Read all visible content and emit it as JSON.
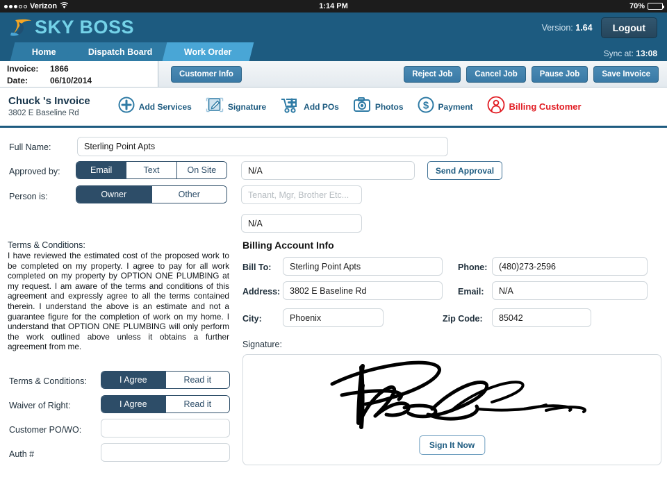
{
  "status_bar": {
    "carrier": "Verizon",
    "signal_dots_filled": 3,
    "signal_dots_empty": 2,
    "wifi_icon": "wifi-icon",
    "time": "1:14 PM",
    "battery_percent": "70%",
    "battery_level": 70
  },
  "header": {
    "brand": "SKY BOSS",
    "version_label": "Version:",
    "version_value": "1.64",
    "logout_label": "Logout",
    "sync_label": "Sync at:",
    "sync_value": "13:08",
    "brand_color": "#1d5b80",
    "logo_text_color": "#74d2e8",
    "logo_accent_color": "#f6a623"
  },
  "tabs": [
    {
      "label": "Home",
      "active": false
    },
    {
      "label": "Dispatch Board",
      "active": false
    },
    {
      "label": "Work Order",
      "active": true
    }
  ],
  "meta": {
    "invoice_label": "Invoice:",
    "invoice_value": "1866",
    "date_label": "Date:",
    "date_value": "06/10/2014",
    "customer_info_label": "Customer Info",
    "actions": [
      {
        "label": "Reject Job"
      },
      {
        "label": "Cancel Job"
      },
      {
        "label": "Pause Job"
      },
      {
        "label": "Save Invoice"
      }
    ]
  },
  "invoice_header": {
    "title": "Chuck 's Invoice",
    "subtitle": "3802 E Baseline Rd",
    "tools": [
      {
        "label": "Add Services",
        "icon": "plus-circle-icon"
      },
      {
        "label": "Signature",
        "icon": "signature-pencil-icon"
      },
      {
        "label": "Add POs",
        "icon": "cart-plus-icon"
      },
      {
        "label": "Photos",
        "icon": "camera-icon"
      },
      {
        "label": "Payment",
        "icon": "dollar-circle-icon"
      },
      {
        "label": "Billing Customer",
        "icon": "person-circle-icon",
        "danger": true
      }
    ],
    "danger_color": "#e11b22"
  },
  "form": {
    "full_name_label": "Full Name:",
    "full_name_value": "Sterling Point Apts",
    "approved_by_label": "Approved by:",
    "approved_by_options": [
      "Email",
      "Text",
      "On Site"
    ],
    "approved_by_selected": "Email",
    "approved_contact_value": "N/A",
    "send_approval_label": "Send Approval",
    "person_is_label": "Person is:",
    "person_is_options": [
      "Owner",
      "Other"
    ],
    "person_is_selected": "Owner",
    "person_relation_placeholder": "Tenant, Mgr, Brother Etc...",
    "person_relation_value": "",
    "person_extra_value": "N/A"
  },
  "terms": {
    "heading": "Terms & Conditions:",
    "body": "I have reviewed the estimated cost of the proposed work to be completed on my property. I agree to pay for all work completed on my property by OPTION ONE PLUMBING at my request. I am aware of the terms and conditions of this agreement and expressly agree to all the terms contained therein. I understand the above is an estimate and not a guarantee figure for the completion of work on my home. I understand that OPTION ONE PLUMBING will only perform the work outlined above unless it obtains a further agreement from me."
  },
  "agreements": {
    "terms_label": "Terms & Conditions:",
    "terms_options": [
      "I Agree",
      "Read it"
    ],
    "terms_selected": "I Agree",
    "waiver_label": "Waiver of Right:",
    "waiver_options": [
      "I Agree",
      "Read it"
    ],
    "waiver_selected": "I Agree",
    "po_label": "Customer PO/WO:",
    "po_value": "",
    "auth_label": "Auth #",
    "auth_value": ""
  },
  "billing": {
    "title": "Billing Account Info",
    "bill_to_label": "Bill To:",
    "bill_to_value": "Sterling Point Apts",
    "phone_label": "Phone:",
    "phone_value": "(480)273-2596",
    "address_label": "Address:",
    "address_value": "3802 E Baseline Rd",
    "email_label": "Email:",
    "email_value": "N/A",
    "city_label": "City:",
    "city_value": "Phoenix",
    "zip_label": "Zip Code:",
    "zip_value": "85042"
  },
  "signature": {
    "label": "Signature:",
    "sign_button_label": "Sign It Now",
    "has_signature": true
  }
}
